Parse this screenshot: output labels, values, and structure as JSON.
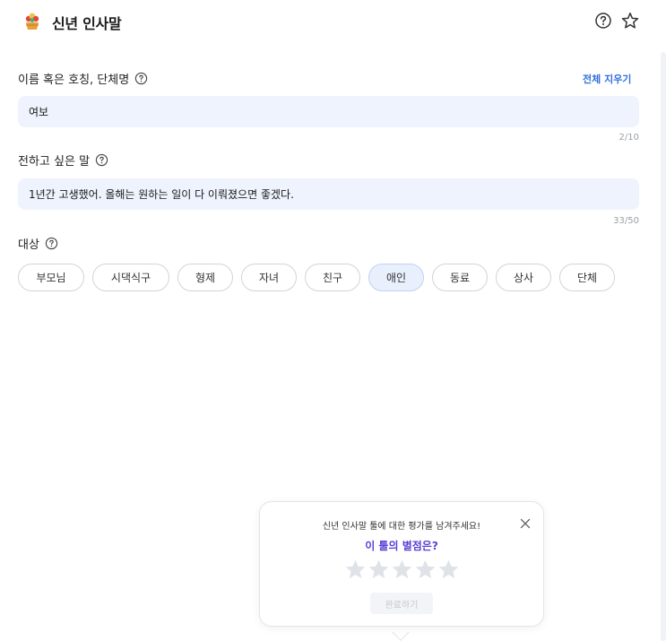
{
  "header": {
    "title": "신년 인사말",
    "icons": [
      "flower-basket-logo-icon",
      "help-circle-icon",
      "star-outline-icon"
    ]
  },
  "name_field": {
    "label": "이름 혹은 호칭, 단체명",
    "value": "여보",
    "counter": "2/10",
    "clear_all": "전체 지우기"
  },
  "message_field": {
    "label": "전하고 싶은 말",
    "value": "1년간 고생했어. 올해는 원하는 일이 다 이뤄졌으면 좋겠다.",
    "counter": "33/50"
  },
  "target": {
    "label": "대상",
    "options": [
      "부모님",
      "시댁식구",
      "형제",
      "자녀",
      "친구",
      "애인",
      "동료",
      "상사",
      "단체"
    ],
    "selected": "애인"
  },
  "rating_popup": {
    "message": "신년 인사말 툴에 대한 평가를 남겨주세요!",
    "question": "이 툴의 별점은?",
    "stars_total": 5,
    "stars_filled": 0,
    "submit_label": "완료하기"
  },
  "colors": {
    "accent_blue": "#2f6fdc",
    "question_purple": "#5a3fd6",
    "input_bg": "#eef3fd",
    "star_empty": "#dfe2e7"
  }
}
